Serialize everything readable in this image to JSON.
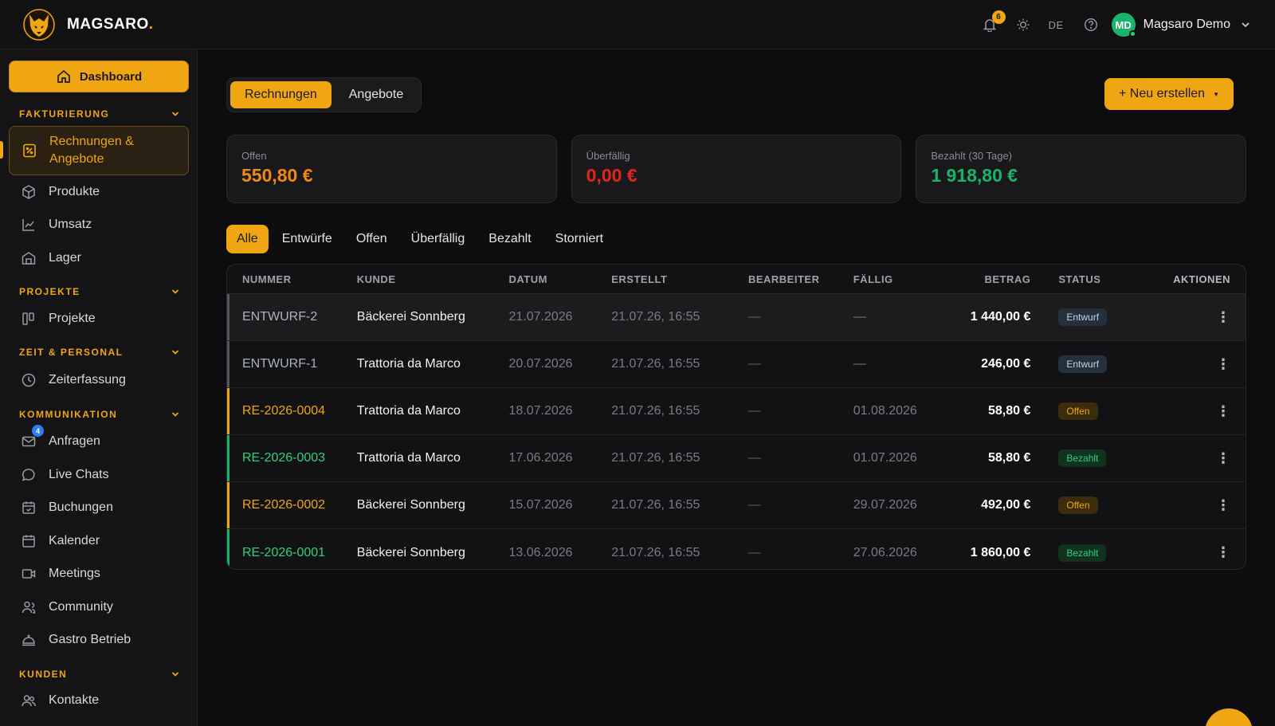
{
  "brand": {
    "name": "MAGSARO",
    "dot": "."
  },
  "topbar": {
    "notifications_count": "6",
    "language": "DE",
    "user_initials": "MD",
    "user_name": "Magsaro Demo"
  },
  "sidebar": {
    "dashboard_label": "Dashboard",
    "sections": {
      "fakturierung": "FAKTURIERUNG",
      "projekte": "PROJEKTE",
      "zeit": "ZEIT & PERSONAL",
      "kommunikation": "KOMMUNIKATION",
      "kunden": "KUNDEN"
    },
    "items": {
      "rechnungen_line1": "Rechnungen &",
      "rechnungen_line2": "Angebote",
      "produkte": "Produkte",
      "umsatz": "Umsatz",
      "lager": "Lager",
      "projekte": "Projekte",
      "zeiterfassung": "Zeiterfassung",
      "anfragen": "Anfragen",
      "anfragen_badge": "4",
      "live_chats": "Live Chats",
      "buchungen": "Buchungen",
      "kalender": "Kalender",
      "meetings": "Meetings",
      "community": "Community",
      "gastro": "Gastro Betrieb",
      "kontakte": "Kontakte"
    }
  },
  "main": {
    "tabs": {
      "rechnungen": "Rechnungen",
      "angebote": "Angebote"
    },
    "new_button": "+ Neu erstellen",
    "cards": {
      "offen_label": "Offen",
      "offen_value": "550,80 €",
      "ueberfaellig_label": "Überfällig",
      "ueberfaellig_value": "0,00 €",
      "bezahlt_label": "Bezahlt (30 Tage)",
      "bezahlt_value": "1 918,80 €"
    },
    "filters": {
      "alle": "Alle",
      "entwuerfe": "Entwürfe",
      "offen": "Offen",
      "ueberfaellig": "Überfällig",
      "bezahlt": "Bezahlt",
      "storniert": "Storniert"
    },
    "table": {
      "headers": {
        "nummer": "NUMMER",
        "kunde": "KUNDE",
        "datum": "DATUM",
        "erstellt": "ERSTELLT",
        "bearbeiter": "BEARBEITER",
        "faellig": "FÄLLIG",
        "betrag": "BETRAG",
        "status": "STATUS",
        "aktionen": "AKTIONEN"
      },
      "rows": [
        {
          "nummer": "ENTWURF-2",
          "kunde": "Bäckerei Sonnberg",
          "datum": "21.07.2026",
          "erstellt": "21.07.26, 16:55",
          "bearbeiter": "—",
          "faellig": "—",
          "betrag": "1 440,00 €",
          "status": "Entwurf",
          "actions": "⋮"
        },
        {
          "nummer": "ENTWURF-1",
          "kunde": "Trattoria da Marco",
          "datum": "20.07.2026",
          "erstellt": "21.07.26, 16:55",
          "bearbeiter": "—",
          "faellig": "—",
          "betrag": "246,00 €",
          "status": "Entwurf",
          "actions": "⋮"
        },
        {
          "nummer": "RE-2026-0004",
          "kunde": "Trattoria da Marco",
          "datum": "18.07.2026",
          "erstellt": "21.07.26, 16:55",
          "bearbeiter": "—",
          "faellig": "01.08.2026",
          "betrag": "58,80 €",
          "status": "Offen",
          "actions": "⋮"
        },
        {
          "nummer": "RE-2026-0003",
          "kunde": "Trattoria da Marco",
          "datum": "17.06.2026",
          "erstellt": "21.07.26, 16:55",
          "bearbeiter": "—",
          "faellig": "01.07.2026",
          "betrag": "58,80 €",
          "status": "Bezahlt",
          "actions": "⋮"
        },
        {
          "nummer": "RE-2026-0002",
          "kunde": "Bäckerei Sonnberg",
          "datum": "15.07.2026",
          "erstellt": "21.07.26, 16:55",
          "bearbeiter": "—",
          "faellig": "29.07.2026",
          "betrag": "492,00 €",
          "status": "Offen",
          "actions": "⋮"
        },
        {
          "nummer": "RE-2026-0001",
          "kunde": "Bäckerei Sonnberg",
          "datum": "13.06.2026",
          "erstellt": "21.07.26, 16:55",
          "bearbeiter": "—",
          "faellig": "27.06.2026",
          "betrag": "1 860,00 €",
          "status": "Bezahlt",
          "actions": "⋮"
        }
      ]
    }
  },
  "colors": {
    "accent": "#f0a512",
    "offen": "#f08a12",
    "ueberfaellig": "#e0261c",
    "bezahlt": "#19b36b",
    "entwurf": "#9aa3ae"
  }
}
